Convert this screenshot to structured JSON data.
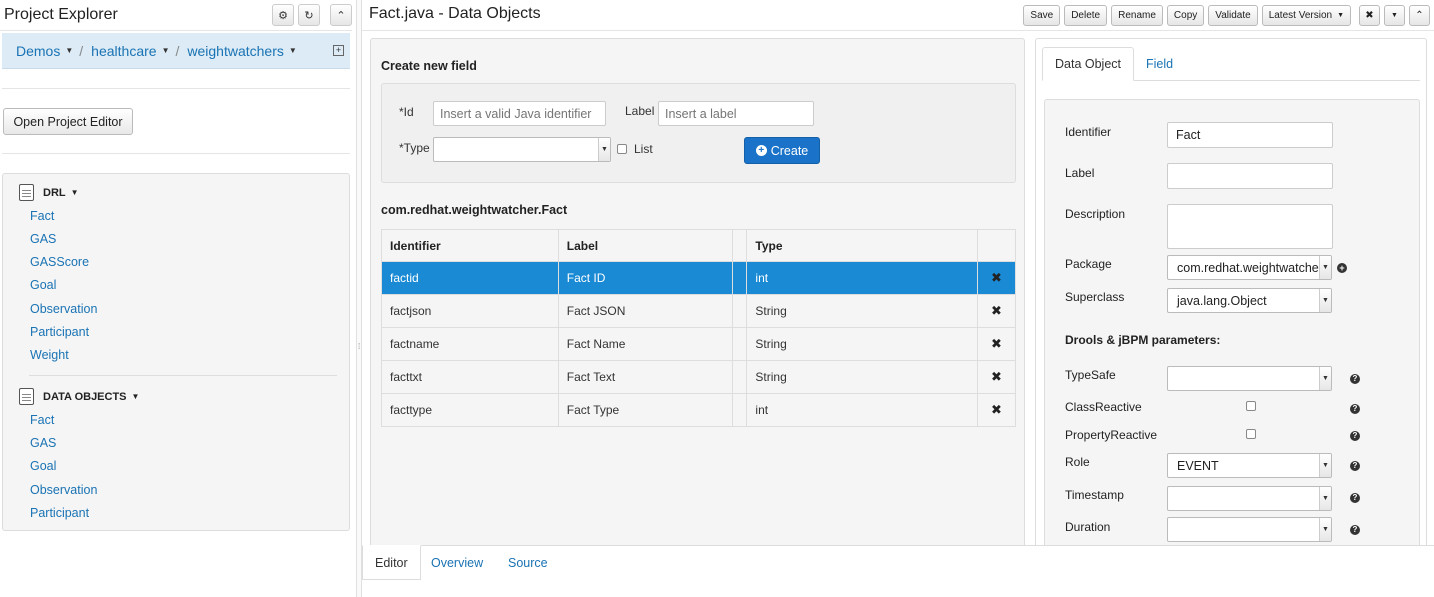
{
  "left": {
    "title": "Project Explorer",
    "breadcrumb": [
      "Demos",
      "healthcare",
      "weightwatchers"
    ],
    "open_editor_label": "Open Project Editor",
    "groups": [
      {
        "name": "DRL",
        "items": [
          "Fact",
          "GAS",
          "GASScore",
          "Goal",
          "Observation",
          "Participant",
          "Weight"
        ]
      },
      {
        "name": "DATA OBJECTS",
        "items": [
          "Fact",
          "GAS",
          "Goal",
          "Observation",
          "Participant"
        ]
      }
    ]
  },
  "main": {
    "title": "Fact.java - Data Objects",
    "actions": [
      "Save",
      "Delete",
      "Rename",
      "Copy",
      "Validate",
      "Latest Version"
    ],
    "create": {
      "heading": "Create new field",
      "id_label": "*Id",
      "id_placeholder": "Insert a valid Java identifier",
      "label_label": "Label",
      "label_placeholder": "Insert a label",
      "type_label": "*Type",
      "list_label": "List",
      "create_label": "Create"
    },
    "class_name": "com.redhat.weightwatcher.Fact",
    "table": {
      "headers": [
        "Identifier",
        "Label",
        "Type"
      ],
      "rows": [
        {
          "id": "factid",
          "label": "Fact ID",
          "type": "int"
        },
        {
          "id": "factjson",
          "label": "Fact JSON",
          "type": "String"
        },
        {
          "id": "factname",
          "label": "Fact Name",
          "type": "String"
        },
        {
          "id": "facttxt",
          "label": "Fact Text",
          "type": "String"
        },
        {
          "id": "facttype",
          "label": "Fact Type",
          "type": "int"
        }
      ],
      "selected_row": 0
    },
    "bottom_tabs": [
      "Editor",
      "Overview",
      "Source"
    ]
  },
  "props": {
    "tabs": [
      "Data Object",
      "Field"
    ],
    "identifier_label": "Identifier",
    "identifier_value": "Fact",
    "label_label": "Label",
    "label_value": "",
    "description_label": "Description",
    "package_label": "Package",
    "package_value": "com.redhat.weightwatcher",
    "superclass_label": "Superclass",
    "superclass_value": "java.lang.Object",
    "section": "Drools & jBPM parameters:",
    "typesafe_label": "TypeSafe",
    "classreactive_label": "ClassReactive",
    "propertyreactive_label": "PropertyReactive",
    "role_label": "Role",
    "role_value": "EVENT",
    "timestamp_label": "Timestamp",
    "duration_label": "Duration"
  },
  "colors": {
    "link": "#1a73b4",
    "selected_row": "#1a8ad4",
    "primary_button": "#1a73c8",
    "breadcrumb_bg": "#dcebf5"
  }
}
